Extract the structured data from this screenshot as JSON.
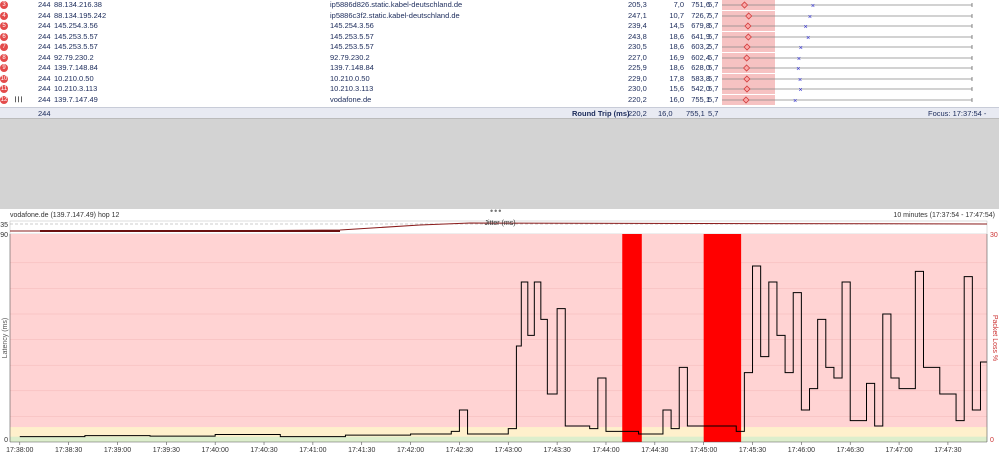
{
  "table": {
    "rows": [
      {
        "hop": "3",
        "count": "244",
        "ip": "88.134.216.38",
        "host": "ip5886d826.static.kabel-deutschland.de",
        "avg": "205,3",
        "min": "7,0",
        "max": "751,6",
        "pl": "5,7",
        "cur_ms": 205.3
      },
      {
        "hop": "4",
        "count": "244",
        "ip": "88.134.195.242",
        "host": "ip5886c3f2.static.kabel-deutschland.de",
        "avg": "247,1",
        "min": "10,7",
        "max": "726,7",
        "pl": "5,7",
        "cur_ms": 247.1
      },
      {
        "hop": "5",
        "count": "244",
        "ip": "145.254.3.56",
        "host": "145.254.3.56",
        "avg": "239,4",
        "min": "14,5",
        "max": "679,8",
        "pl": "5,7",
        "cur_ms": 239.4
      },
      {
        "hop": "6",
        "count": "244",
        "ip": "145.253.5.57",
        "host": "145.253.5.57",
        "avg": "243,8",
        "min": "18,6",
        "max": "641,9",
        "pl": "5,7",
        "cur_ms": 243.8
      },
      {
        "hop": "7",
        "count": "244",
        "ip": "145.253.5.57",
        "host": "145.253.5.57",
        "avg": "230,5",
        "min": "18,6",
        "max": "603,2",
        "pl": "5,7",
        "cur_ms": 230.5
      },
      {
        "hop": "8",
        "count": "244",
        "ip": "92.79.230.2",
        "host": "92.79.230.2",
        "avg": "227,0",
        "min": "16,9",
        "max": "602,4",
        "pl": "5,7",
        "cur_ms": 227.0
      },
      {
        "hop": "9",
        "count": "244",
        "ip": "139.7.148.84",
        "host": "139.7.148.84",
        "avg": "225,9",
        "min": "18,6",
        "max": "628,0",
        "pl": "5,7",
        "cur_ms": 225.9
      },
      {
        "hop": "10",
        "count": "244",
        "ip": "10.210.0.50",
        "host": "10.210.0.50",
        "avg": "229,0",
        "min": "17,8",
        "max": "583,8",
        "pl": "5,7",
        "cur_ms": 229.0
      },
      {
        "hop": "11",
        "count": "244",
        "ip": "10.210.3.113",
        "host": "10.210.3.113",
        "avg": "230,0",
        "min": "15,6",
        "max": "542,0",
        "pl": "5,7",
        "cur_ms": 230.0
      },
      {
        "hop": "12",
        "count": "244",
        "ip": "139.7.147.49",
        "host": "vodafone.de",
        "avg": "220,2",
        "min": "16,0",
        "max": "755,1",
        "pl": "5,7",
        "cur_ms": 220.2
      }
    ]
  },
  "summary": {
    "count": "244",
    "label": "Round Trip (ms)",
    "avg": "220,2",
    "min": "16,0",
    "max": "755,1",
    "pl": "5,7",
    "focus": "Focus: 17:37:54 - 17:47:54"
  },
  "chart_header": {
    "left": "vodafone.de (139.7.147.49) hop 12",
    "right": "10 minutes (17:37:54 - 17:47:54)",
    "jitter_label": "Jitter (ms)",
    "jitter_max": "35"
  },
  "chart_data": {
    "type": "line",
    "ylabel": "Latency (ms)",
    "y2label": "Packet Loss %",
    "ylim": [
      0,
      390
    ],
    "y_ticks": [
      "390",
      "0"
    ],
    "y2_ticks": [
      "30",
      "0"
    ],
    "x_ticks": [
      "17:38:00",
      "17:38:30",
      "17:39:00",
      "17:39:30",
      "17:40:00",
      "17:40:30",
      "17:41:00",
      "17:41:30",
      "17:42:00",
      "17:42:30",
      "17:43:00",
      "17:43:30",
      "17:44:00",
      "17:44:30",
      "17:45:00",
      "17:45:30",
      "17:46:00",
      "17:46:30",
      "17:47:00",
      "17:47:30"
    ],
    "x_start_s": -6,
    "x_end_s": 594,
    "latency": [
      [
        0,
        10
      ],
      [
        40,
        12
      ],
      [
        80,
        11
      ],
      [
        120,
        14
      ],
      [
        160,
        10
      ],
      [
        200,
        13
      ],
      [
        240,
        15
      ],
      [
        265,
        20
      ],
      [
        270,
        60
      ],
      [
        275,
        15
      ],
      [
        300,
        25
      ],
      [
        305,
        180
      ],
      [
        308,
        300
      ],
      [
        312,
        200
      ],
      [
        316,
        300
      ],
      [
        320,
        230
      ],
      [
        324,
        90
      ],
      [
        330,
        250
      ],
      [
        335,
        30
      ],
      [
        350,
        25
      ],
      [
        355,
        120
      ],
      [
        360,
        20
      ],
      [
        380,
        15
      ],
      [
        395,
        60
      ],
      [
        400,
        25
      ],
      [
        405,
        140
      ],
      [
        410,
        30
      ],
      [
        440,
        20
      ],
      [
        445,
        130
      ],
      [
        450,
        330
      ],
      [
        455,
        160
      ],
      [
        460,
        300
      ],
      [
        465,
        200
      ],
      [
        470,
        130
      ],
      [
        475,
        280
      ],
      [
        480,
        60
      ],
      [
        485,
        100
      ],
      [
        490,
        230
      ],
      [
        495,
        140
      ],
      [
        500,
        120
      ],
      [
        505,
        300
      ],
      [
        510,
        40
      ],
      [
        520,
        110
      ],
      [
        525,
        30
      ],
      [
        530,
        240
      ],
      [
        535,
        120
      ],
      [
        540,
        100
      ],
      [
        550,
        320
      ],
      [
        555,
        140
      ],
      [
        565,
        90
      ],
      [
        575,
        40
      ],
      [
        580,
        310
      ],
      [
        585,
        60
      ],
      [
        590,
        150
      ],
      [
        594,
        150
      ]
    ],
    "loss_spans": [
      [
        370,
        382
      ],
      [
        420,
        443
      ]
    ],
    "loss_color": "#ff0000",
    "bg_color": "#ffd3d3",
    "good_band_color": "#ddeecc",
    "line_color": "#000000",
    "jitter_color": "#8a1c1c"
  }
}
